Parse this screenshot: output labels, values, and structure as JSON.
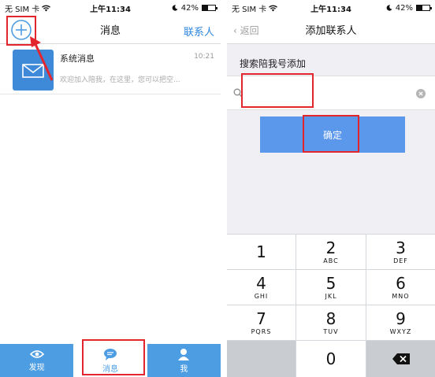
{
  "status_bar": {
    "carrier": "无 SIM 卡",
    "time": "上午11:34",
    "battery": "42%",
    "battery_level": 0.42
  },
  "left_screen": {
    "nav": {
      "title": "消息",
      "contacts_link": "联系人"
    },
    "message": {
      "title": "系统消息",
      "time": "10:21",
      "preview": "欢迎加入陪我，在这里，您可以把空..."
    },
    "tabs": [
      {
        "label": "发现",
        "icon": "eye-icon"
      },
      {
        "label": "消息",
        "icon": "chat-icon"
      },
      {
        "label": "我",
        "icon": "person-icon"
      }
    ]
  },
  "right_screen": {
    "nav": {
      "back": "返回",
      "title": "添加联系人"
    },
    "section_label": "搜索陪我号添加",
    "confirm_label": "确定",
    "keys": [
      {
        "num": "1",
        "letters": ""
      },
      {
        "num": "2",
        "letters": "ABC"
      },
      {
        "num": "3",
        "letters": "DEF"
      },
      {
        "num": "4",
        "letters": "GHI"
      },
      {
        "num": "5",
        "letters": "JKL"
      },
      {
        "num": "6",
        "letters": "MNO"
      },
      {
        "num": "7",
        "letters": "PQRS"
      },
      {
        "num": "8",
        "letters": "TUV"
      },
      {
        "num": "9",
        "letters": "WXYZ"
      },
      {
        "num": "0",
        "letters": ""
      }
    ]
  },
  "colors": {
    "accent_blue": "#4d9de3",
    "button_blue": "#5b97ea",
    "highlight_red": "#e3262e"
  }
}
